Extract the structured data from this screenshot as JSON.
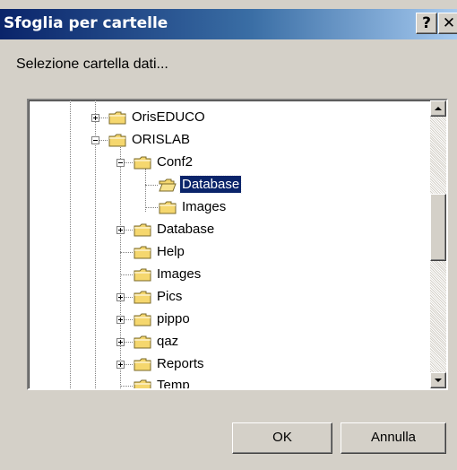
{
  "window": {
    "title": "Sfoglia per cartelle",
    "help_label": "?",
    "close_label": "✕"
  },
  "prompt": "Selezione cartella dati...",
  "tree": {
    "items": [
      {
        "label": "OrisEDUCO",
        "expander": "plus"
      },
      {
        "label": "ORISLAB",
        "expander": "minus"
      },
      {
        "label": "Conf2",
        "expander": "minus"
      },
      {
        "label": "Database",
        "expander": "none",
        "selected": true,
        "open": true
      },
      {
        "label": "Images",
        "expander": "none"
      },
      {
        "label": "Database",
        "expander": "plus"
      },
      {
        "label": "Help",
        "expander": "none"
      },
      {
        "label": "Images",
        "expander": "none"
      },
      {
        "label": "Pics",
        "expander": "plus"
      },
      {
        "label": "pippo",
        "expander": "plus"
      },
      {
        "label": "qaz",
        "expander": "plus"
      },
      {
        "label": "Reports",
        "expander": "plus"
      },
      {
        "label": "Temp",
        "expander": "none"
      }
    ]
  },
  "buttons": {
    "ok": "OK",
    "cancel": "Annulla"
  },
  "colors": {
    "title_active": "#0a246a",
    "selection": "#0a246a",
    "face": "#d4d0c8",
    "folder": "#f5d76e"
  }
}
